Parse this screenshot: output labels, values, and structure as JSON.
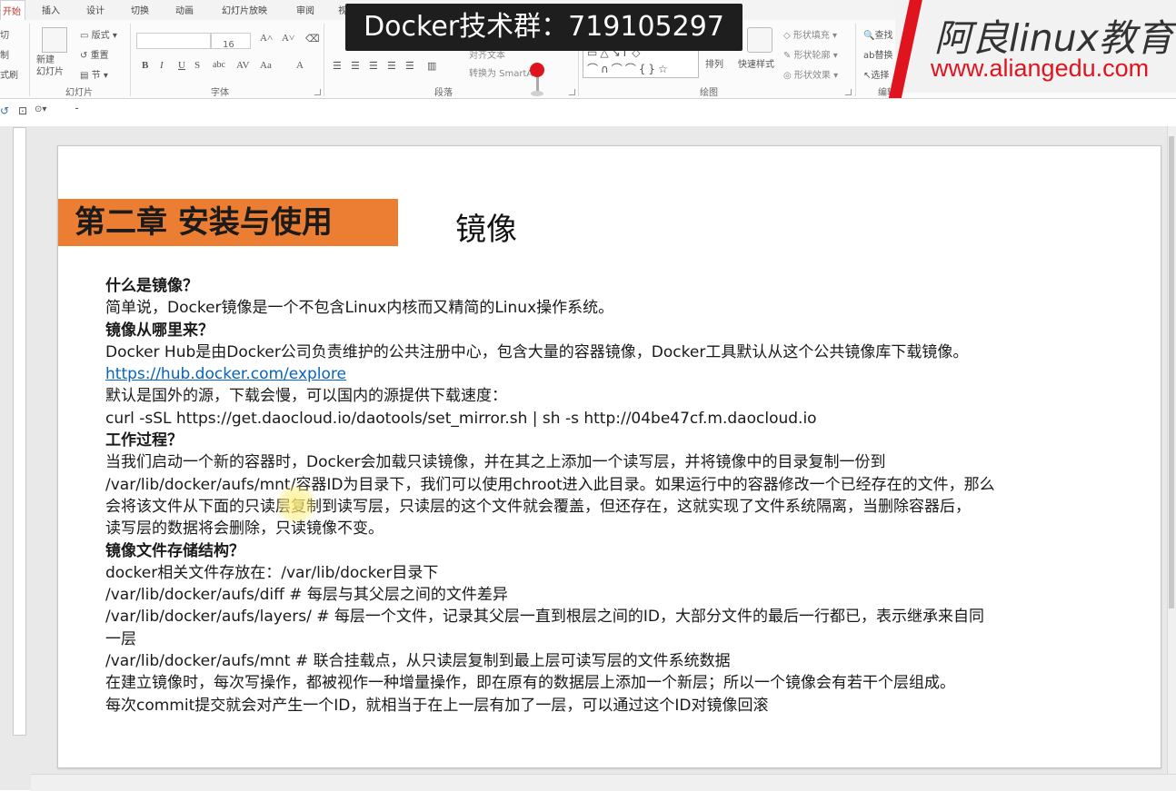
{
  "ribbon": {
    "tabs": [
      "开始",
      "插入",
      "设计",
      "切换",
      "动画",
      "幻灯片放映",
      "审阅",
      "视图"
    ],
    "clipboard_fragments": [
      "切",
      "制",
      "式刷"
    ],
    "slides_group": {
      "new_slide": "新建\n幻灯片",
      "layout": "版式",
      "reset": "重置",
      "section": "节",
      "label": "幻灯片"
    },
    "font_group": {
      "font_size": "16",
      "label": "字体"
    },
    "paragraph_group": {
      "label": "段落",
      "align_text": "对齐文本",
      "convert_smartart": "转换为 SmartArt"
    },
    "drawing_group": {
      "label": "绘图",
      "arrange": "排列",
      "quick_styles": "快速样式",
      "shape_fill": "形状填充",
      "shape_outline": "形状轮廓",
      "shape_effects": "形状效果"
    },
    "editing_group": {
      "find": "查找",
      "replace": "替换",
      "select": "选择",
      "label": "编辑"
    }
  },
  "banner": {
    "text": "Docker技术群：719105297"
  },
  "watermark": {
    "name": "阿良linux教育",
    "url": "www.aliangedu.com"
  },
  "slide": {
    "chapter_label": "第二章 安装与使用",
    "title": "镜像",
    "lines": [
      {
        "text": "什么是镜像？",
        "bold": true
      },
      {
        "text": "简单说，Docker镜像是一个不包含Linux内核而又精简的Linux操作系统。"
      },
      {
        "text": "镜像从哪里来？",
        "bold": true
      },
      {
        "text": "Docker Hub是由Docker公司负责维护的公共注册中心，包含大量的容器镜像，Docker工具默认从这个公共镜像库下载镜像。"
      },
      {
        "text": "https://hub.docker.com/explore",
        "link": true
      },
      {
        "text": "默认是国外的源，下载会慢，可以国内的源提供下载速度："
      },
      {
        "text": "curl -sSL https://get.daocloud.io/daotools/set_mirror.sh | sh -s  http://04be47cf.m.daocloud.io"
      },
      {
        "text": "工作过程？",
        "bold": true
      },
      {
        "text": "当我们启动一个新的容器时，Docker会加载只读镜像，并在其之上添加一个读写层，并将镜像中的目录复制一份到"
      },
      {
        "text": "/var/lib/docker/aufs/mnt/容器ID为目录下，我们可以使用chroot进入此目录。如果运行中的容器修改一个已经存在的文件，那么"
      },
      {
        "text": "会将该文件从下面的只读层复制到读写层，只读层的这个文件就会覆盖，但还存在，这就实现了文件系统隔离，当删除容器后，"
      },
      {
        "text": "读写层的数据将会删除，只读镜像不变。"
      },
      {
        "text": "镜像文件存储结构？",
        "bold": true
      },
      {
        "text": "docker相关文件存放在：/var/lib/docker目录下"
      },
      {
        "text": "/var/lib/docker/aufs/diff         # 每层与其父层之间的文件差异"
      },
      {
        "text": "/var/lib/docker/aufs/layers/    # 每层一个文件，记录其父层一直到根层之间的ID，大部分文件的最后一行都已，表示继承来自同"
      },
      {
        "text": "一层"
      },
      {
        "text": "/var/lib/docker/aufs/mnt         # 联合挂载点，从只读层复制到最上层可读写层的文件系统数据"
      },
      {
        "text": "在建立镜像时，每次写操作，都被视作一种增量操作，即在原有的数据层上添加一个新层；所以一个镜像会有若干个层组成。"
      },
      {
        "text": "每次commit提交就会对产生一个ID，就相当于在上一层有加了一层，可以通过这个ID对镜像回滚"
      }
    ]
  }
}
